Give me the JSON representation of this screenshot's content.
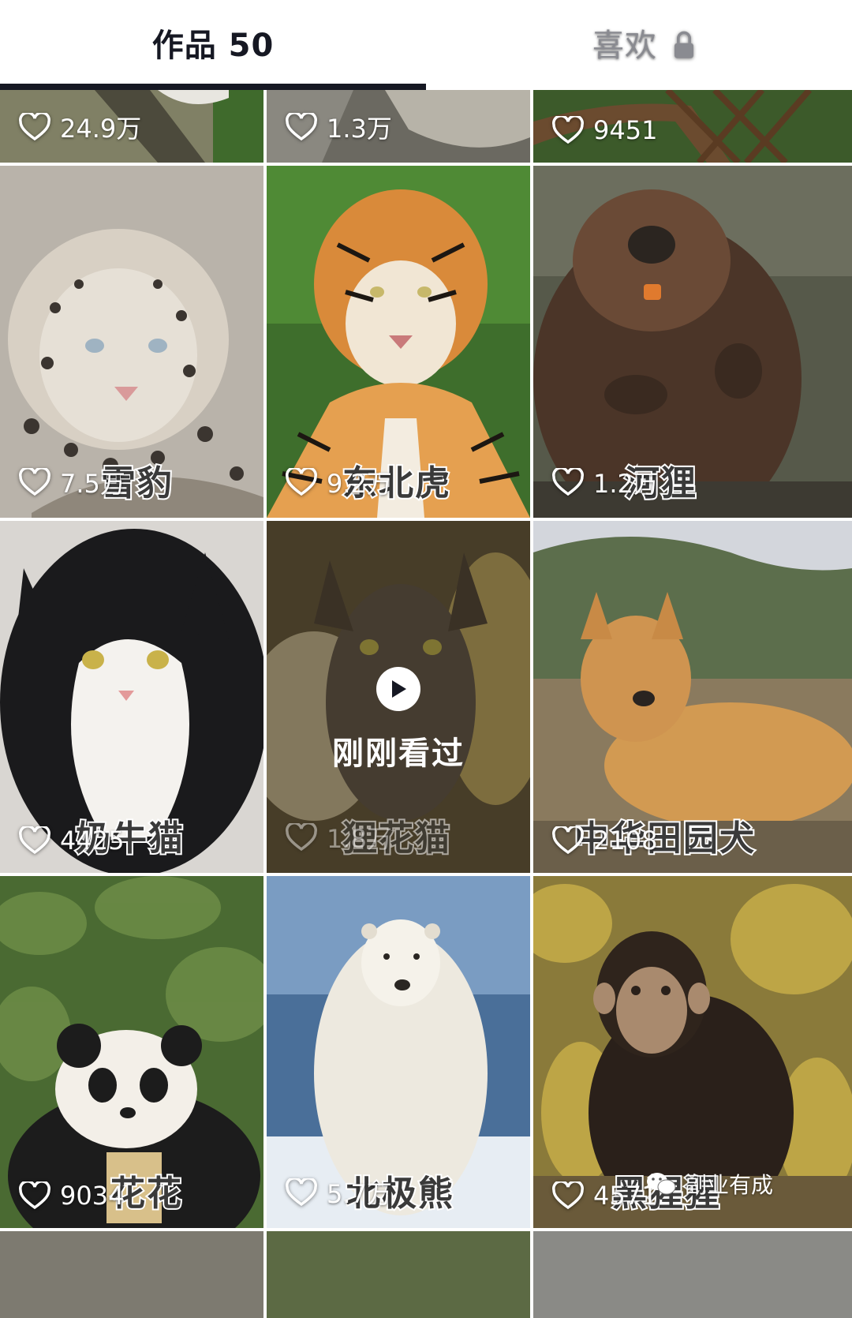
{
  "tabs": {
    "works_label": "作品 50",
    "likes_label": "喜欢",
    "likes_locked": true
  },
  "videos": [
    {
      "likes": "24.9万",
      "caption": ""
    },
    {
      "likes": "1.3万",
      "caption": ""
    },
    {
      "likes": "9451",
      "caption": ""
    },
    {
      "likes": "7.5万",
      "caption": "雪豹"
    },
    {
      "likes": "9.2万",
      "caption": "东北虎"
    },
    {
      "likes": "1.2万",
      "caption": "河狸"
    },
    {
      "likes": "4425",
      "caption": "奶牛猫"
    },
    {
      "likes": "1.8万",
      "caption": "狸花猫",
      "watched_label": "刚刚看过"
    },
    {
      "likes": "2108",
      "caption": "中华田园犬"
    },
    {
      "likes": "9034",
      "caption": "花花"
    },
    {
      "likes": "5.7万",
      "caption": "北极熊"
    },
    {
      "likes": "4571",
      "caption": "黑猩猩"
    }
  ],
  "watermark": "副业有成",
  "colors": {
    "tab_active": "#161823",
    "tab_inactive": "#8a8b91"
  }
}
